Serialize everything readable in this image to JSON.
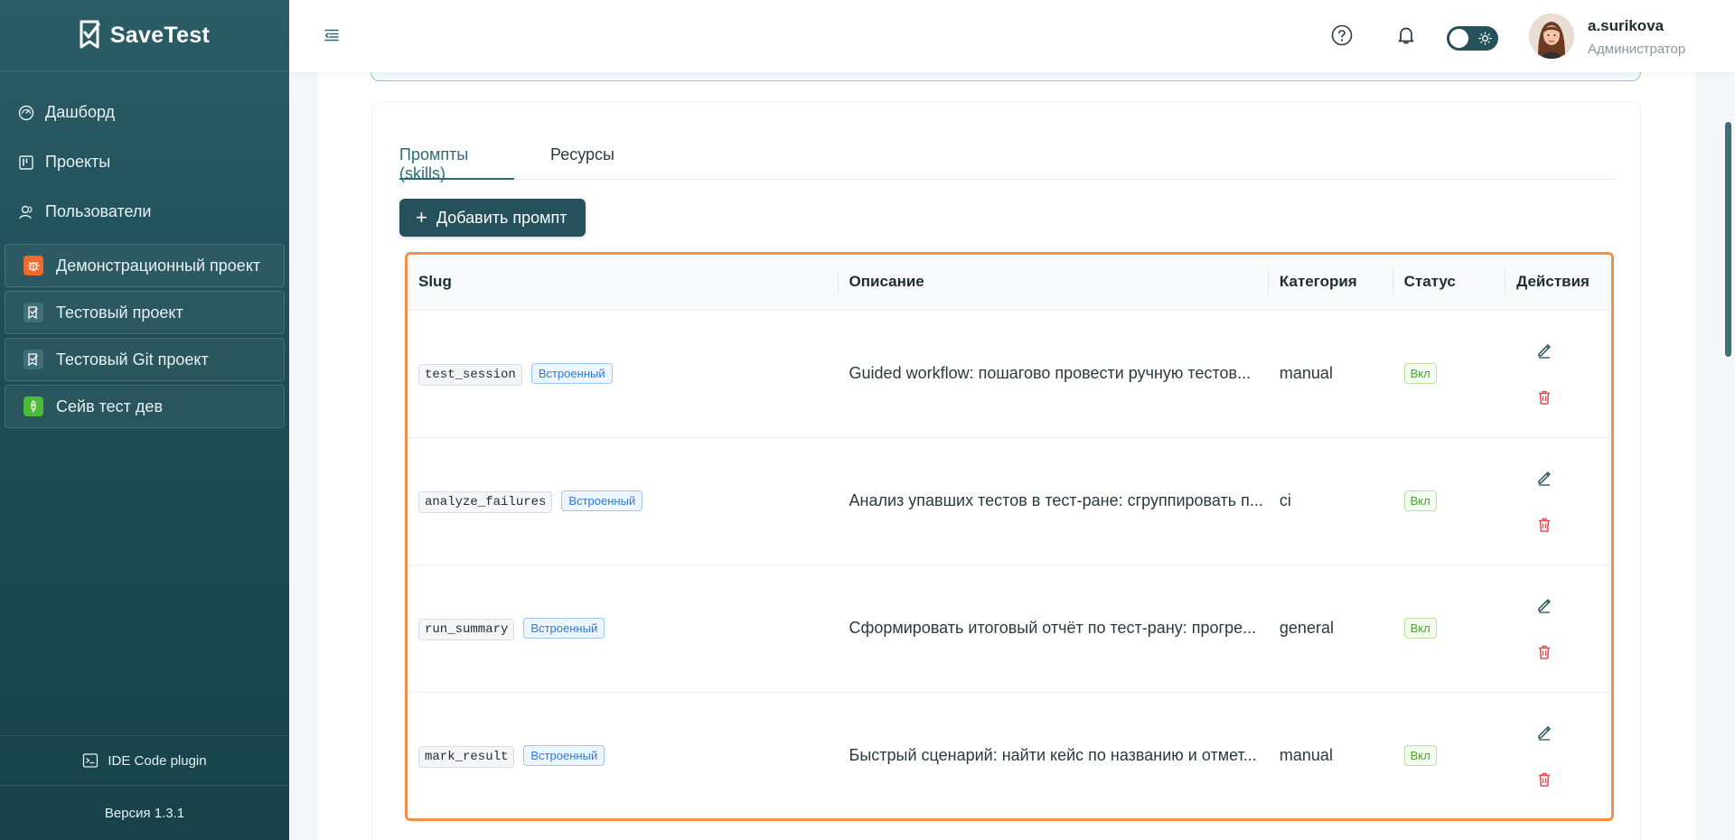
{
  "app": {
    "name": "SaveTest"
  },
  "sidebar": {
    "nav": [
      {
        "label": "Дашборд",
        "icon": "dashboard-icon"
      },
      {
        "label": "Проекты",
        "icon": "projects-icon"
      },
      {
        "label": "Пользователи",
        "icon": "users-icon"
      }
    ],
    "projects": [
      {
        "label": "Демонстрационный проект",
        "color": "#f26a2a",
        "icon": "bug-icon"
      },
      {
        "label": "Тестовый проект",
        "color": "#3f6f78",
        "icon": "checklist-icon"
      },
      {
        "label": "Тестовый Git проект",
        "color": "#3f6f78",
        "icon": "checklist-icon"
      },
      {
        "label": "Сейв тест дев",
        "color": "#4cbb3a",
        "icon": "rocket-icon"
      }
    ],
    "ide_plugin": "IDE Code plugin",
    "version": "Версия 1.3.1"
  },
  "header": {
    "user": {
      "name": "a.surikova",
      "role": "Администратор"
    }
  },
  "tabs": [
    {
      "label": "Промпты (skills)",
      "active": true
    },
    {
      "label": "Ресурсы",
      "active": false
    }
  ],
  "add_button": "Добавить промпт",
  "table": {
    "columns": [
      "Slug",
      "Описание",
      "Категория",
      "Статус",
      "Действия"
    ],
    "rows": [
      {
        "slug": "test_session",
        "badge": "Встроенный",
        "description": "Guided workflow: пошагово провести ручную тестов...",
        "category": "manual",
        "status": "Вкл"
      },
      {
        "slug": "analyze_failures",
        "badge": "Встроенный",
        "description": "Анализ упавших тестов в тест-ране: сгруппировать п...",
        "category": "ci",
        "status": "Вкл"
      },
      {
        "slug": "run_summary",
        "badge": "Встроенный",
        "description": "Сформировать итоговый отчёт по тест-рану: прогре...",
        "category": "general",
        "status": "Вкл"
      },
      {
        "slug": "mark_result",
        "badge": "Встроенный",
        "description": "Быстрый сценарий: найти кейс по названию и отмет...",
        "category": "manual",
        "status": "Вкл"
      }
    ]
  },
  "colors": {
    "primary": "#24515b",
    "highlight": "#f0924d",
    "delete": "#e5484d",
    "builtin": "#2f7ad8",
    "status_on": "#4aa532"
  }
}
